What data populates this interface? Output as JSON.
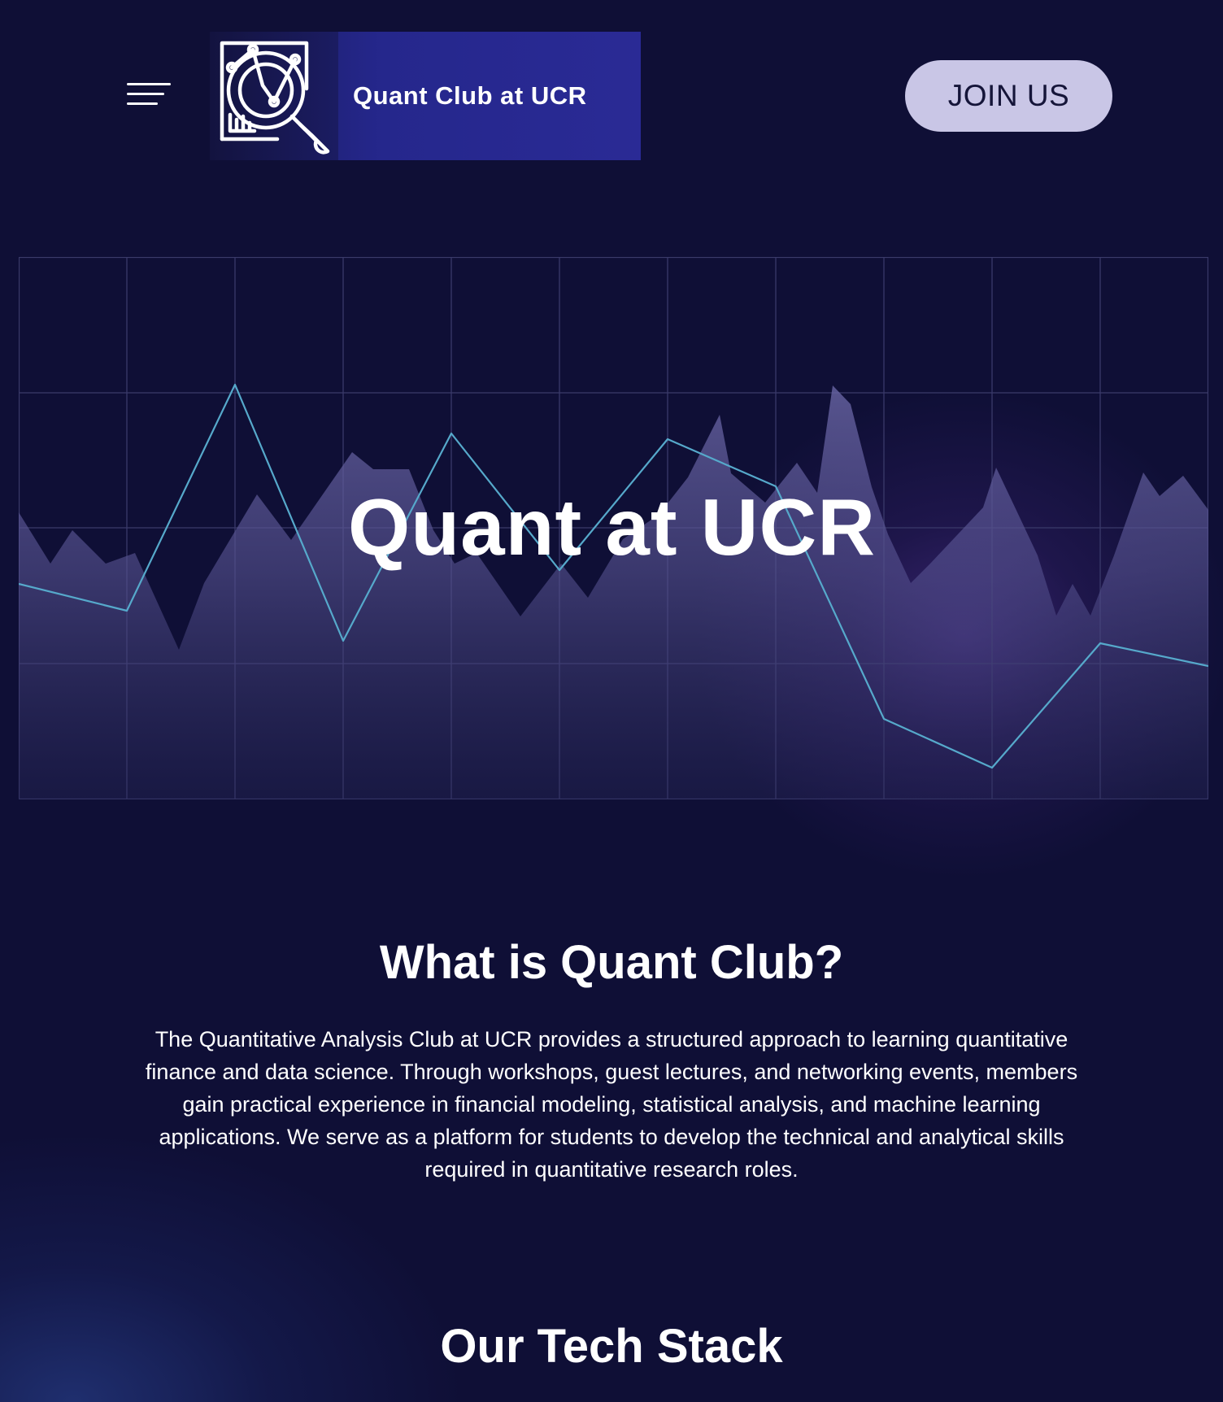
{
  "header": {
    "brand_name": "Quant Club at UCR",
    "join_label": "JOIN US",
    "logo_icon": "chart-magnifier-icon",
    "menu_icon": "menu-icon"
  },
  "hero": {
    "title": "Quant at UCR",
    "colors": {
      "line": "#56a9cb",
      "area": "#6c68a8",
      "grid": "#3a3a6a"
    }
  },
  "about": {
    "heading": "What is Quant Club?",
    "body": "The Quantitative Analysis Club at UCR provides a structured approach to learning quantitative finance and data science. Through workshops, guest lectures, and networking events, members gain practical experience in financial modeling, statistical analysis, and machine learning applications. We serve as a platform for students to develop the technical and analytical skills required in quantitative research roles."
  },
  "tech": {
    "heading": "Our Tech Stack"
  },
  "colors": {
    "background": "#0f0f36",
    "brand_band": "#2a2a95",
    "join_button": "#c9c6e6"
  }
}
